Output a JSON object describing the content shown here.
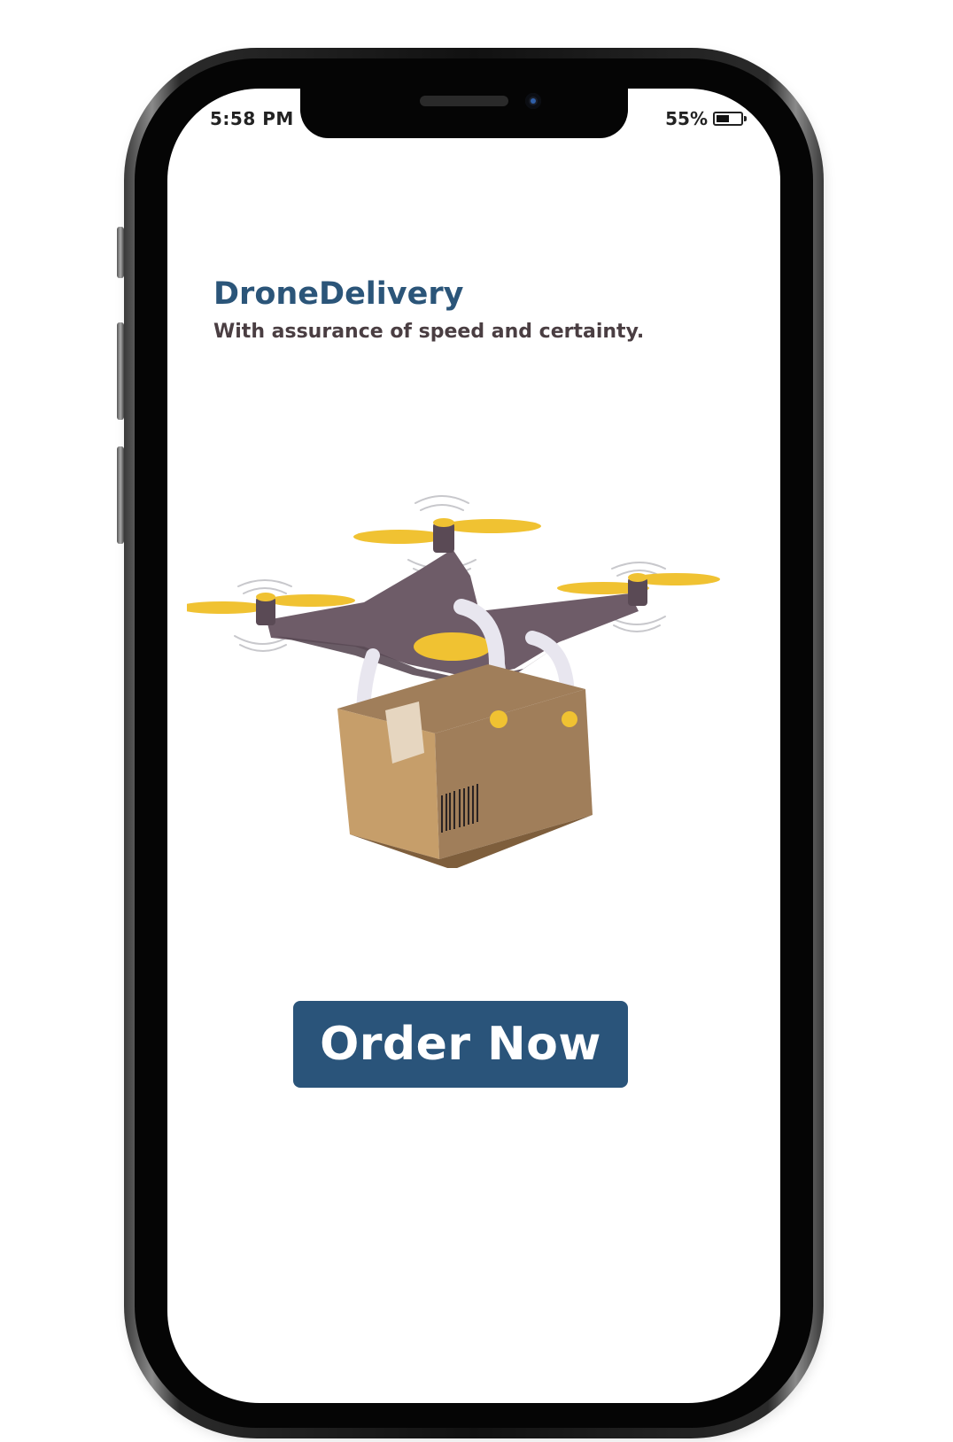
{
  "status_bar": {
    "time": "5:58 PM",
    "battery_percent_label": "55%",
    "battery_level": 0.55
  },
  "app": {
    "title": "DroneDelivery",
    "tagline": "With assurance of speed and certainty."
  },
  "hero_illustration": {
    "subject": "drone-carrying-package",
    "colors": {
      "drone_body": "#6e5c68",
      "propeller": "#f0c232",
      "landing_gear": "#e8e6ef",
      "box_light": "#c69e6a",
      "box_right": "#a07e5a",
      "box_bottom": "#7e5e3c",
      "label": "#e6d6c0"
    }
  },
  "primary_action": {
    "label": "Order Now",
    "color": "#2a547a"
  }
}
